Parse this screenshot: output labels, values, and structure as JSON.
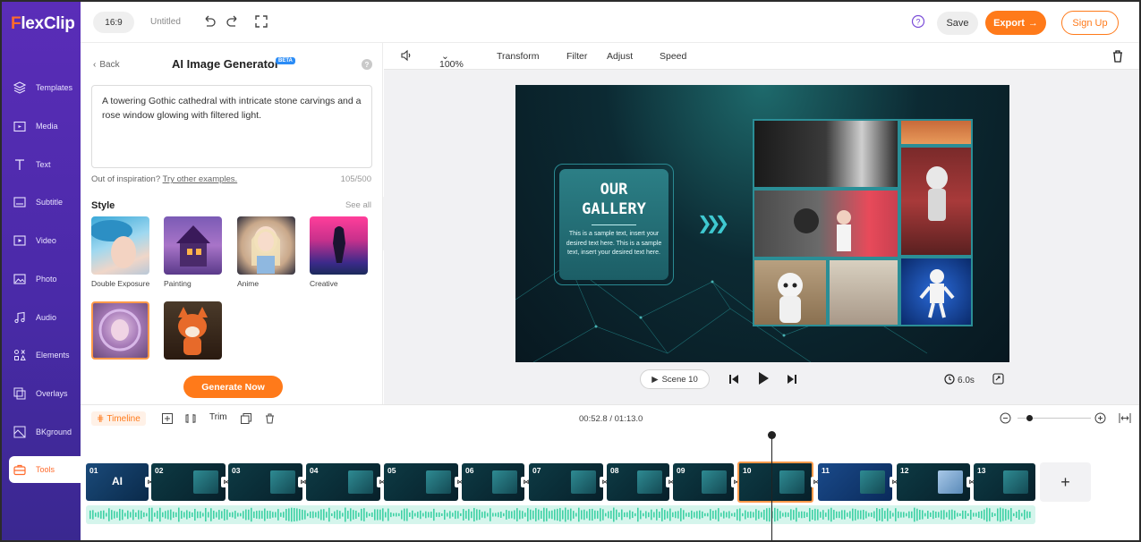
{
  "app": {
    "logo_prefix": "F",
    "logo_rest": "lexClip"
  },
  "topbar": {
    "ratio": "16:9",
    "title": "Untitled",
    "save": "Save",
    "export": "Export",
    "signup": "Sign Up"
  },
  "nav": {
    "items": [
      {
        "label": "Templates",
        "icon": "layers-icon"
      },
      {
        "label": "Media",
        "icon": "folder-icon"
      },
      {
        "label": "Text",
        "icon": "text-icon"
      },
      {
        "label": "Subtitle",
        "icon": "subtitle-icon"
      },
      {
        "label": "Video",
        "icon": "video-icon"
      },
      {
        "label": "Photo",
        "icon": "photo-icon"
      },
      {
        "label": "Audio",
        "icon": "music-icon"
      },
      {
        "label": "Elements",
        "icon": "elements-icon"
      },
      {
        "label": "Overlays",
        "icon": "overlays-icon"
      },
      {
        "label": "BKground",
        "icon": "background-icon"
      },
      {
        "label": "Tools",
        "icon": "toolbox-icon"
      }
    ],
    "active": "Tools"
  },
  "panel": {
    "back": "Back",
    "title": "AI Image Generator",
    "beta": "BETA",
    "prompt": "A towering Gothic cathedral with intricate stone carvings and a rose window glowing with filtered light.",
    "inspire_prefix": "Out of inspiration?",
    "inspire_link": "Try other examples.",
    "char_count": "105/500",
    "style_label": "Style",
    "see_all": "See all",
    "styles": [
      "Double Exposure",
      "Painting",
      "Anime",
      "Creative",
      "",
      ""
    ],
    "generate": "Generate Now"
  },
  "editor": {
    "zoom": "100%",
    "tools": [
      "Transform",
      "Filter",
      "Adjust",
      "Speed"
    ],
    "canvas": {
      "title_line1": "OUR",
      "title_line2": "GALLERY",
      "body": "This is a sample text, insert your desired text here. This is a sample text, insert your desired text here."
    },
    "scene": "Scene 10",
    "duration": "6.0s"
  },
  "timeline": {
    "label": "Timeline",
    "trim": "Trim",
    "time": "00:52.8 / 01:13.0",
    "clips": [
      "01",
      "02",
      "03",
      "04",
      "05",
      "06",
      "07",
      "08",
      "09",
      "10",
      "11",
      "12",
      "13"
    ],
    "clip1_text": "AI",
    "selected_clip": "10",
    "add": "+"
  },
  "colors": {
    "accent": "#ff7a1a",
    "nav": "#4a2aa8",
    "audio": "#3fd1a5"
  }
}
